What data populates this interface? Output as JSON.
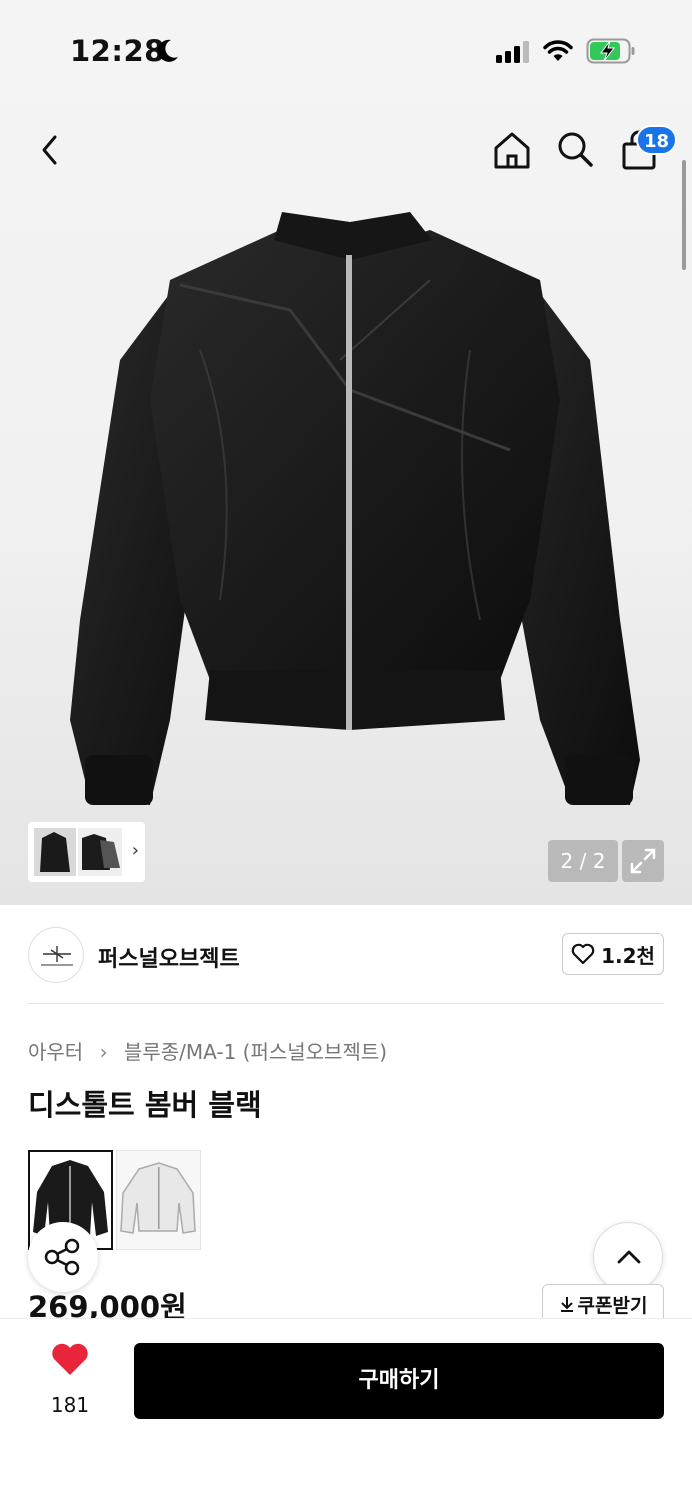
{
  "status_bar": {
    "time": "12:28",
    "moon_icon": "moon-icon",
    "signal_icon": "cellular-signal-icon",
    "wifi_icon": "wifi-icon",
    "battery_icon": "battery-charging-icon",
    "battery_color": "#34c759"
  },
  "nav": {
    "back_icon": "chevron-left-icon",
    "home_icon": "home-icon",
    "search_icon": "search-icon",
    "cart_icon": "shopping-bag-icon",
    "cart_count": "18",
    "badge_color": "#1a73e8"
  },
  "gallery": {
    "counter": "2 / 2",
    "expand_icon": "expand-icon"
  },
  "brand": {
    "name": "퍼스널오브젝트",
    "likes": "1.2천"
  },
  "breadcrumb": {
    "category": "아우터",
    "subcategory": "블루종/MA-1 (퍼스널오브젝트)"
  },
  "product": {
    "title": "디스톨트 봄버 블랙",
    "price": "269,000원"
  },
  "coupon": {
    "label": "쿠폰받기"
  },
  "bottom": {
    "like_count": "181",
    "like_color": "#e8253a",
    "buy_label": "구매하기"
  }
}
